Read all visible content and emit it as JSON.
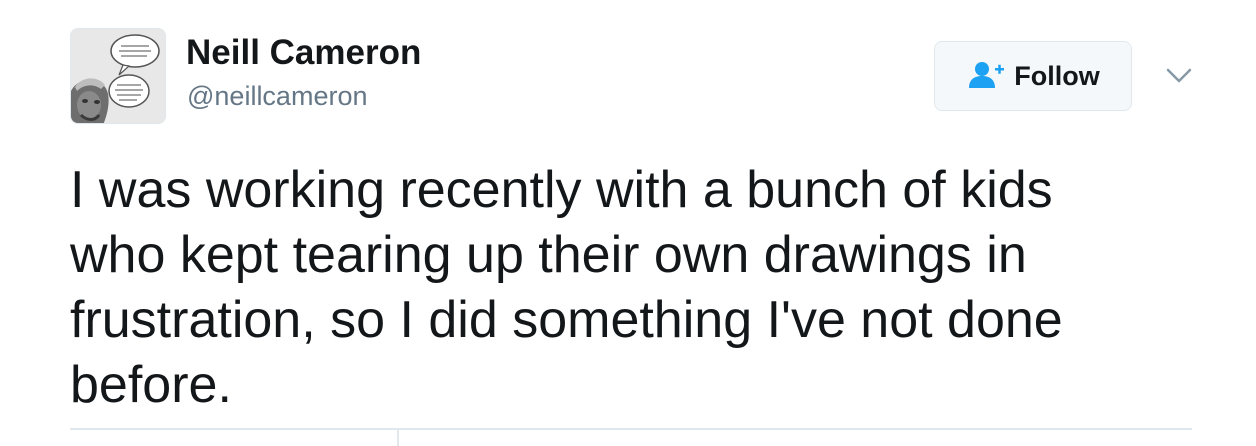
{
  "tweet": {
    "author": {
      "display_name": "Neill Cameron",
      "handle": "@neillcameron",
      "avatar_icon": "avatar-photo"
    },
    "follow_button": {
      "label": "Follow",
      "icon": "follow-user-icon",
      "icon_color": "#1da1f2"
    },
    "menu_icon": "chevron-down-icon",
    "text_lines": [
      "I was working recently with a bunch of kids",
      "who kept tearing up their own drawings in",
      "frustration, so I did something I've not done",
      "before."
    ]
  }
}
